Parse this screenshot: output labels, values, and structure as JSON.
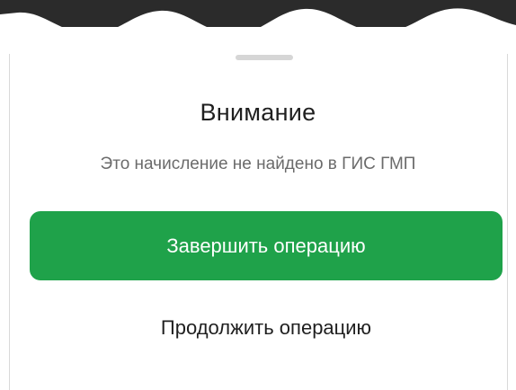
{
  "dialog": {
    "title": "Внимание",
    "message": "Это начисление не найдено в ГИС ГМП",
    "primary_button_label": "Завершить операцию",
    "secondary_button_label": "Продолжить операцию"
  },
  "colors": {
    "primary": "#1fa24a",
    "backdrop": "#2b2b2b",
    "title_text": "#1f1f1f",
    "message_text": "#6b6b6b"
  }
}
